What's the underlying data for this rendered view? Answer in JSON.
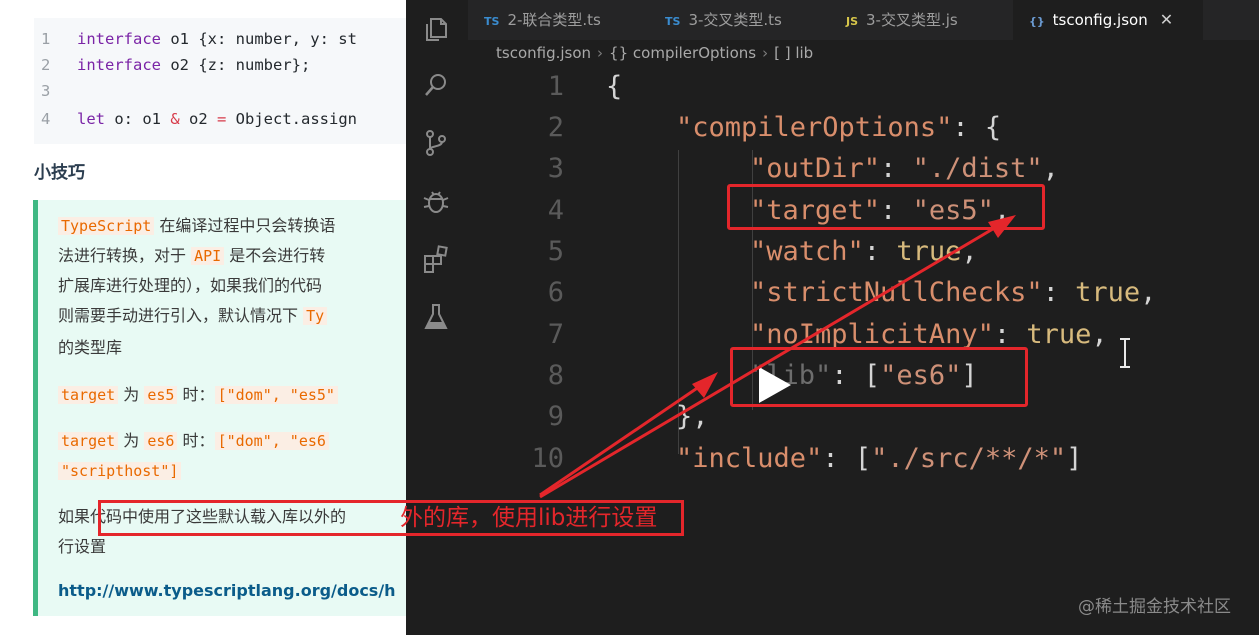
{
  "doc": {
    "code_lines": [
      {
        "n": "1",
        "kw": "interface",
        "rest": " o1 {x: number, y: st"
      },
      {
        "n": "2",
        "kw": "interface",
        "rest": " o2 {z: number};"
      },
      {
        "n": "3",
        "kw": "",
        "rest": ""
      },
      {
        "n": "4",
        "kw": "let",
        "rest": " o: o1 & o2 = Object.assign"
      }
    ],
    "heading": "小技巧",
    "tip": {
      "p1_hl1": "TypeScript",
      "p1_l1_rest": " 在编译过程中只会转换语",
      "p1_l2a": "法进行转换，对于 ",
      "p1_hl2": "API",
      "p1_l2b": " 是不会进行转",
      "p1_l3": "扩展库进行处理的），如果我们的代码",
      "p1_l4a": "则需要手动进行引入，默认情况下 ",
      "p1_hl3": "Ty",
      "p1_l5": "的类型库",
      "t1_a": "target",
      "t1_wei": " 为 ",
      "t1_b": "es5",
      "t1_shi": " 时：",
      "t1_c": "[\"dom\", \"es5\"",
      "t2_a": "target",
      "t2_wei": " 为 ",
      "t2_b": "es6",
      "t2_shi": " 时：",
      "t2_c": "[\"dom\", \"es6",
      "t2_d": "\"scripthost\"]",
      "p3_l1": "如果代码中使用了这些默认载入库以外的",
      "p3_l2": "行设置",
      "link": "http://www.typescriptlang.org/docs/h"
    }
  },
  "vscode": {
    "tabs": [
      {
        "badge": "TS",
        "label": "2-联合类型.ts",
        "active": false
      },
      {
        "badge": "TS",
        "label": "3-交叉类型.ts",
        "active": false
      },
      {
        "badge": "JS",
        "label": "3-交叉类型.js",
        "active": false
      },
      {
        "badge": "{}",
        "label": "tsconfig.json",
        "active": true,
        "close": "✕"
      }
    ],
    "breadcrumb": [
      "tsconfig.json",
      "{} compilerOptions",
      "[ ] lib"
    ],
    "lines": [
      {
        "n": "1"
      },
      {
        "n": "2"
      },
      {
        "n": "3"
      },
      {
        "n": "4"
      },
      {
        "n": "5"
      },
      {
        "n": "6"
      },
      {
        "n": "7"
      },
      {
        "n": "8"
      },
      {
        "n": "9"
      },
      {
        "n": "10"
      }
    ],
    "code": {
      "l1": "{",
      "l2_key": "\"compilerOptions\"",
      "l2_rest": ": {",
      "l3_key": "\"outDir\"",
      "l3_val": "\"./dist\"",
      "l4_key": "\"target\"",
      "l4_val": "\"es5\"",
      "l5_key": "\"watch\"",
      "l5_val": "true",
      "l6_key": "\"strictNullChecks\"",
      "l6_val": "true",
      "l7_key": "\"noImplicitAny\"",
      "l7_val": "true",
      "l8_key": "\"lib\"",
      "l8_val": "\"es6\"",
      "l9": "},",
      "l10_key": "\"include\"",
      "l10_val": "\"./src/**/*\""
    }
  },
  "annotation": {
    "caption": "外的库，使用lib进行设置",
    "accent": "#e4262b"
  },
  "watermark": "@稀土掘金技术社区"
}
